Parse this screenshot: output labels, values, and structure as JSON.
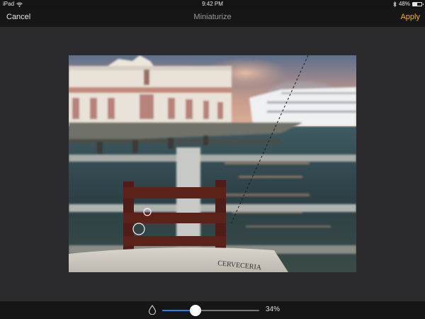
{
  "status_bar": {
    "device": "iPad",
    "wifi_icon": "wifi-icon",
    "time": "9:42 PM",
    "bluetooth_icon": "bluetooth-icon",
    "battery_percent_text": "48%",
    "battery_level": 0.48
  },
  "nav": {
    "cancel_label": "Cancel",
    "title": "Miniaturize",
    "apply_label": "Apply",
    "apply_color": "#f3b21b"
  },
  "photo": {
    "description_icon": "photo-canvas",
    "sign_text": "CERVECERIA"
  },
  "blur_slider": {
    "icon": "drop-icon",
    "value": 0.34,
    "value_label": "34%",
    "accent_color": "#2f7cf6"
  }
}
